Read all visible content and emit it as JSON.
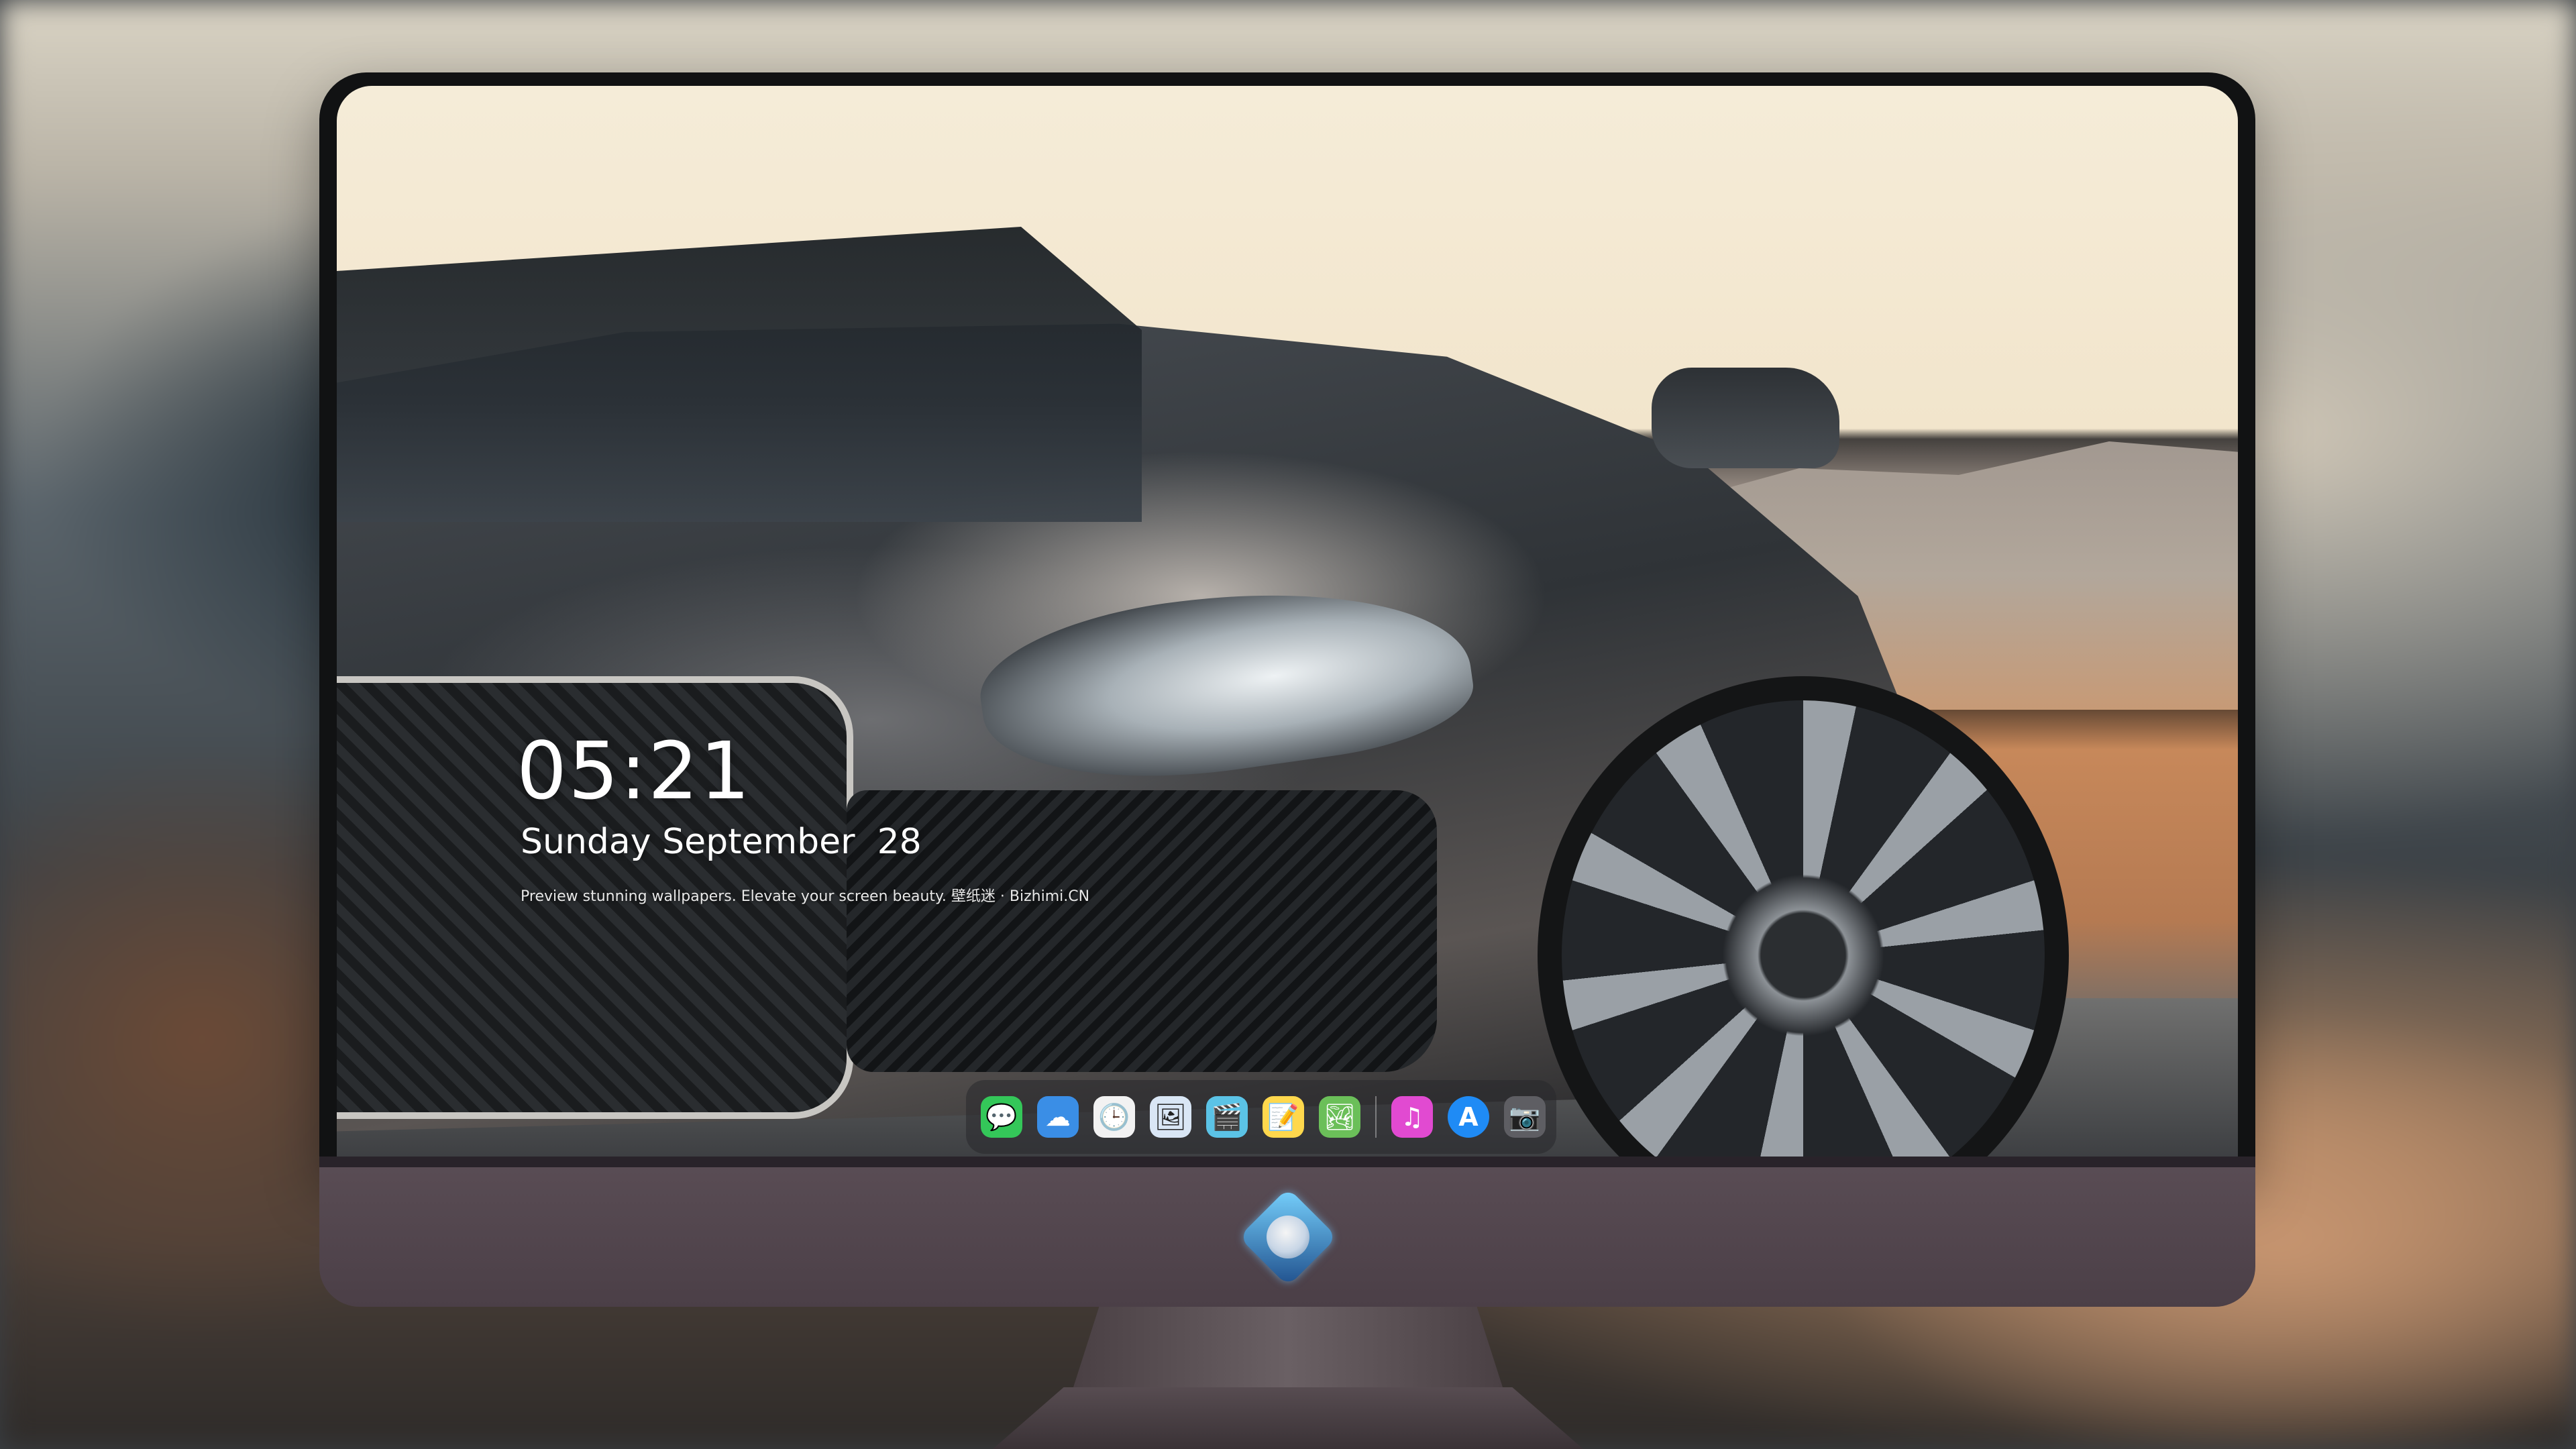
{
  "lockscreen": {
    "time": "05:21",
    "date": "Sunday September  28",
    "tagline": "Preview stunning wallpapers. Elevate your screen beauty. 壁纸迷 · Bizhimi.CN"
  },
  "dock": {
    "items": [
      {
        "id": "messages",
        "icon": "message-bubble-icon",
        "glyph": "💬",
        "color": "#34c759"
      },
      {
        "id": "weather",
        "icon": "cloud-icon",
        "glyph": "☁",
        "color": "#3a8ee6"
      },
      {
        "id": "clock",
        "icon": "clock-icon",
        "glyph": "🕒",
        "color": "#f2f2f2"
      },
      {
        "id": "preview",
        "icon": "photo-viewer-icon",
        "glyph": "🖼",
        "color": "#d9e6f5"
      },
      {
        "id": "clips",
        "icon": "clapperboard-icon",
        "glyph": "🎬",
        "color": "#5bc3e6"
      },
      {
        "id": "notes",
        "icon": "notes-icon",
        "glyph": "📝",
        "color": "#ffd84d"
      },
      {
        "id": "photo-booth",
        "icon": "photo-stack-icon",
        "glyph": "🏞",
        "color": "#6bbf59"
      },
      {
        "id": "music",
        "icon": "music-note-icon",
        "glyph": "♫",
        "color": "#e14ad1"
      },
      {
        "id": "app-store",
        "icon": "app-store-icon",
        "glyph": "A",
        "color": "#1f8bf5"
      },
      {
        "id": "camera",
        "icon": "camera-icon",
        "glyph": "📷",
        "color": "#5e5e63"
      }
    ]
  },
  "colors": {
    "chin": "#4b3f47",
    "bezel": "#111213",
    "dock_background": "rgba(40,40,44,0.55)"
  }
}
